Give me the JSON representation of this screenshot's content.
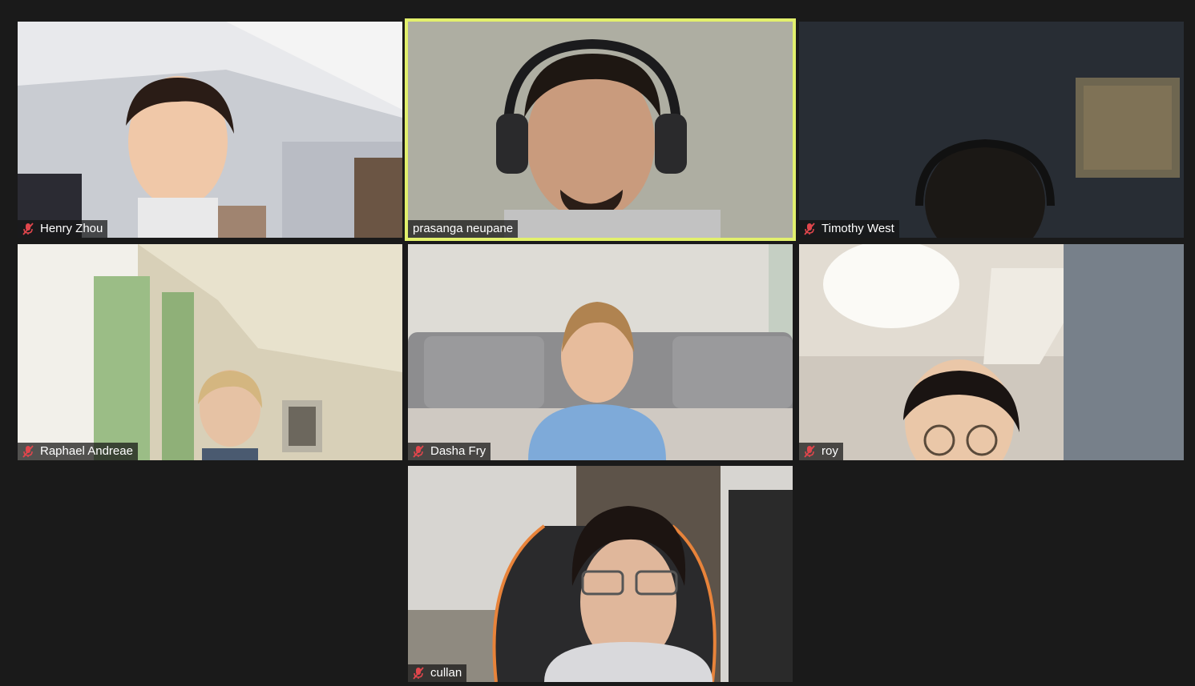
{
  "meeting": {
    "layout": "gallery-view",
    "active_speaker_color": "#e2f06c",
    "muted_icon_color": "#e0464c",
    "participants": [
      {
        "name": "Henry Zhou",
        "muted": true,
        "speaking": false
      },
      {
        "name": "prasanga neupane",
        "muted": false,
        "speaking": true
      },
      {
        "name": "Timothy West",
        "muted": true,
        "speaking": false
      },
      {
        "name": "Raphael Andreae",
        "muted": true,
        "speaking": false
      },
      {
        "name": "Dasha Fry",
        "muted": true,
        "speaking": false
      },
      {
        "name": "roy",
        "muted": true,
        "speaking": false
      },
      {
        "name": "cullan",
        "muted": true,
        "speaking": false
      }
    ]
  }
}
